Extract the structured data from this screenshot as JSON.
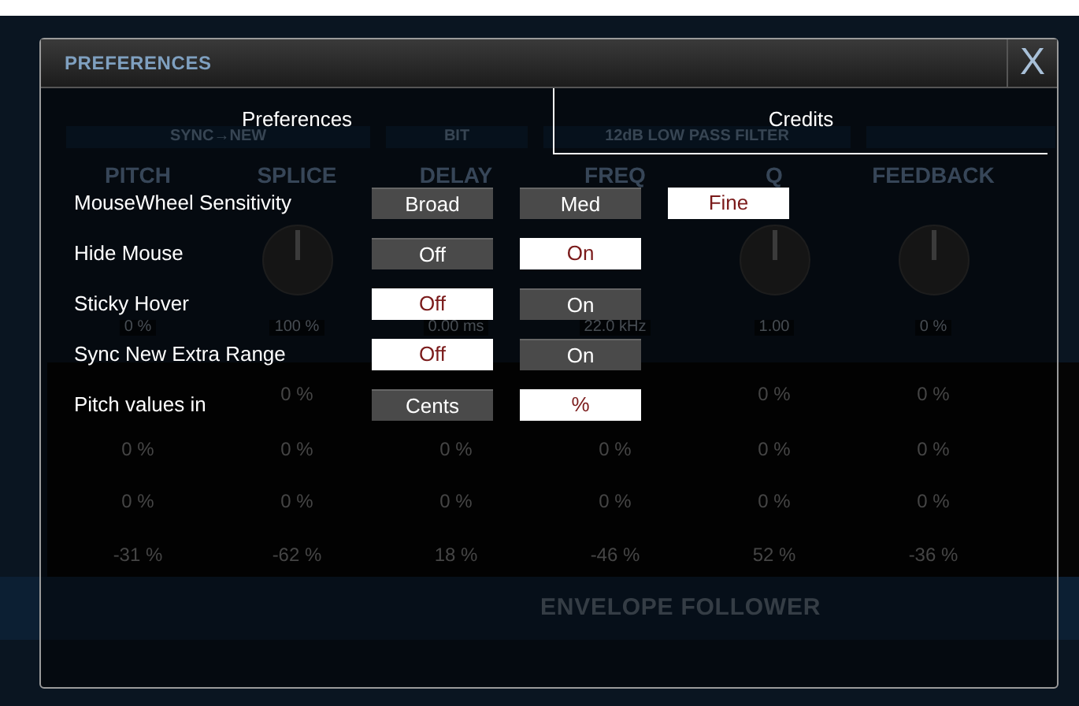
{
  "background": {
    "bars": [
      "SYNC→NEW",
      "BIT",
      "12dB LOW PASS FILTER"
    ],
    "columns": [
      {
        "header": "PITCH",
        "knob": false,
        "display": "0 %",
        "row_2": "0 %",
        "row_3": "0 %",
        "row_4": "-31 %"
      },
      {
        "header": "SPLICE",
        "knob": true,
        "display": "100 %",
        "row_1": "0 %",
        "row_2": "0 %",
        "row_3": "0 %",
        "row_4": "-62 %"
      },
      {
        "header": "DELAY",
        "knob": false,
        "display": "0.00 ms",
        "row_2": "0 %",
        "row_3": "0 %",
        "row_4": "18 %"
      },
      {
        "header": "FREQ",
        "knob": false,
        "display": "22.0 kHz",
        "row_2": "0 %",
        "row_3": "0 %",
        "row_4": "-46 %"
      },
      {
        "header": "Q",
        "knob": true,
        "display": "1.00",
        "row_1": "0 %",
        "row_2": "0 %",
        "row_3": "0 %",
        "row_4": "52 %"
      },
      {
        "header": "FEEDBACK",
        "knob": true,
        "display": "0 %",
        "row_1": "0 %",
        "row_2": "0 %",
        "row_3": "0 %",
        "row_4": "-36 %"
      }
    ],
    "section": "ENVELOPE FOLLOWER"
  },
  "dialog": {
    "title": "PREFERENCES",
    "close": "X",
    "tabs": [
      {
        "label": "Preferences",
        "selected": true
      },
      {
        "label": "Credits",
        "selected": false
      }
    ],
    "settings": [
      {
        "label": "MouseWheel Sensitivity",
        "options": [
          {
            "label": "Broad",
            "selected": false
          },
          {
            "label": "Med",
            "selected": false
          },
          {
            "label": "Fine",
            "selected": true
          }
        ]
      },
      {
        "label": "Hide Mouse",
        "options": [
          {
            "label": "Off",
            "selected": false
          },
          {
            "label": "On",
            "selected": true
          }
        ]
      },
      {
        "label": "Sticky Hover",
        "options": [
          {
            "label": "Off",
            "selected": true
          },
          {
            "label": "On",
            "selected": false
          }
        ]
      },
      {
        "label": "Sync New Extra Range",
        "options": [
          {
            "label": "Off",
            "selected": true
          },
          {
            "label": "On",
            "selected": false
          }
        ]
      },
      {
        "label": "Pitch values in",
        "options": [
          {
            "label": "Cents",
            "selected": false
          },
          {
            "label": "%",
            "selected": true
          }
        ]
      }
    ]
  }
}
